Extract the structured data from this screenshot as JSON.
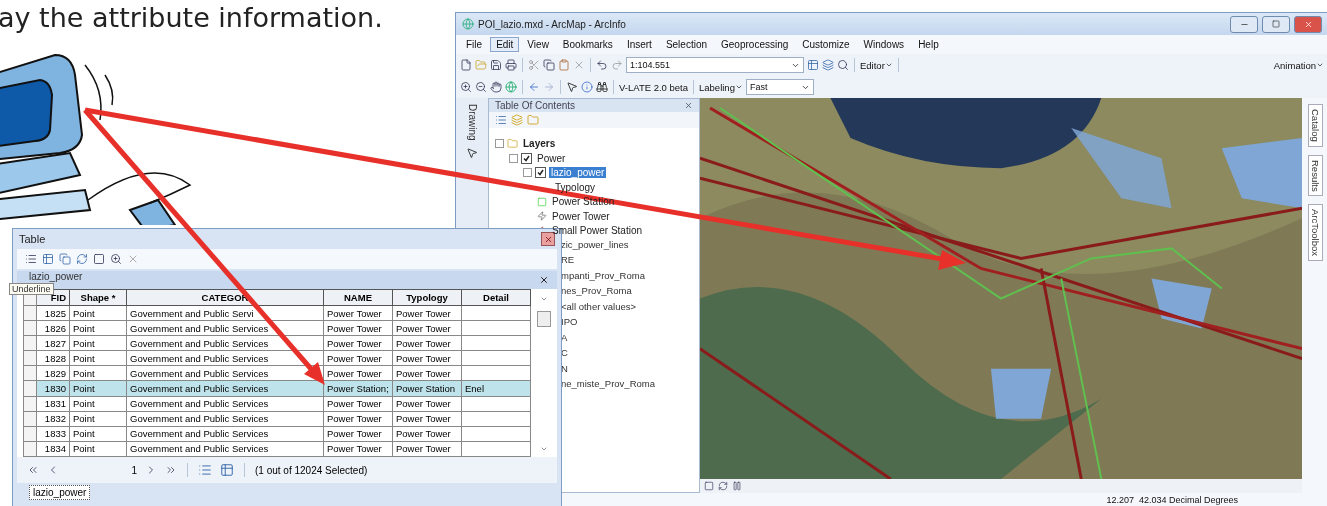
{
  "caption": "ay the attribute information.",
  "arcmap": {
    "title": "POI_lazio.mxd - ArcMap - ArcInfo",
    "menu": [
      {
        "label": "File",
        "selected": false
      },
      {
        "label": "Edit",
        "selected": true
      },
      {
        "label": "View",
        "selected": false
      },
      {
        "label": "Bookmarks",
        "selected": false
      },
      {
        "label": "Insert",
        "selected": false
      },
      {
        "label": "Selection",
        "selected": false
      },
      {
        "label": "Geoprocessing",
        "selected": false
      },
      {
        "label": "Customize",
        "selected": false
      },
      {
        "label": "Windows",
        "selected": false
      },
      {
        "label": "Help",
        "selected": false
      }
    ],
    "scale": "1:104.551",
    "editor_menu": "Editor",
    "animation_menu": "Animation",
    "vlate": "V-LATE 2.0 beta",
    "labeling_menu": "Labeling",
    "quality": "Fast",
    "drawing_toolbar": "Drawing",
    "toc": {
      "title": "Table Of Contents",
      "items": [
        {
          "label": "Layers",
          "kind": "group",
          "selected": false,
          "children": [
            {
              "label": "Power",
              "checked": true,
              "selected": false,
              "children": [
                {
                  "label": "lazio_power",
                  "checked": true,
                  "selected": true,
                  "children": [
                    {
                      "label": "Typology",
                      "kind": "heading",
                      "selected": false
                    },
                    {
                      "label": "Power Station",
                      "kind": "station",
                      "selected": false
                    },
                    {
                      "label": "Power Tower",
                      "kind": "tower",
                      "selected": false
                    },
                    {
                      "label": "Small Power Station",
                      "kind": "small",
                      "selected": false
                    }
                  ]
                }
              ]
            }
          ]
        }
      ],
      "partial_items": [
        "zic_power_lines",
        "RE",
        "mpanti_Prov_Roma",
        "nes_Prov_Roma",
        "<all other values>",
        "IPO",
        "A",
        "C",
        "N",
        "ne_miste_Prov_Roma"
      ]
    },
    "side_tabs": [
      "Catalog",
      "Results",
      "ArcToolbox"
    ],
    "status": "12.207  42.034 Decimal Degrees"
  },
  "table": {
    "title": "Table",
    "tab": "lazio_power",
    "tooltip": "Underline",
    "columns": [
      "FID",
      "Shape *",
      "CATEGOR",
      "NAME",
      "Typology",
      "Detail"
    ],
    "rows": [
      {
        "cells": [
          "1825",
          "Point",
          "Government and Public Servi",
          "Power Tower",
          "Power Tower",
          ""
        ],
        "selected": false
      },
      {
        "cells": [
          "1826",
          "Point",
          "Government and Public Services",
          "Power Tower",
          "Power Tower",
          ""
        ],
        "selected": false
      },
      {
        "cells": [
          "1827",
          "Point",
          "Government and Public Services",
          "Power Tower",
          "Power Tower",
          ""
        ],
        "selected": false
      },
      {
        "cells": [
          "1828",
          "Point",
          "Government and Public Services",
          "Power Tower",
          "Power Tower",
          ""
        ],
        "selected": false
      },
      {
        "cells": [
          "1829",
          "Point",
          "Government and Public Services",
          "Power Tower",
          "Power Tower",
          ""
        ],
        "selected": false
      },
      {
        "cells": [
          "1830",
          "Point",
          "Government and Public Services",
          "Power Station;",
          "Power Station",
          "Enel"
        ],
        "selected": true
      },
      {
        "cells": [
          "1831",
          "Point",
          "Government and Public Services",
          "Power Tower",
          "Power Tower",
          ""
        ],
        "selected": false
      },
      {
        "cells": [
          "1832",
          "Point",
          "Government and Public Services",
          "Power Tower",
          "Power Tower",
          ""
        ],
        "selected": false
      },
      {
        "cells": [
          "1833",
          "Point",
          "Government and Public Services",
          "Power Tower",
          "Power Tower",
          ""
        ],
        "selected": false
      },
      {
        "cells": [
          "1834",
          "Point",
          "Government and Public Services",
          "Power Tower",
          "Power Tower",
          ""
        ],
        "selected": false
      }
    ],
    "record": "1",
    "selection_info": "(1 out of 12024 Selected)",
    "bottom_tab": "lazio_power"
  }
}
